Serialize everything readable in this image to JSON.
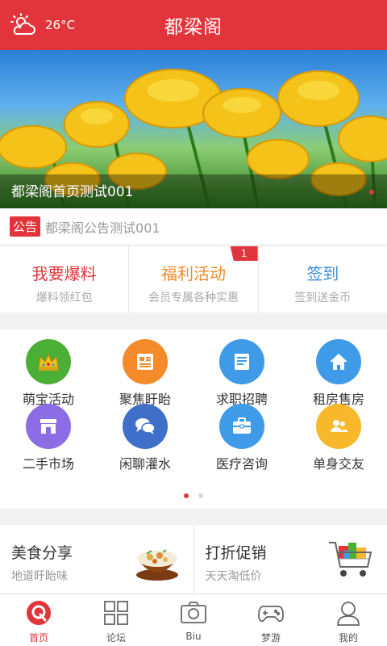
{
  "header": {
    "title": "都梁阁",
    "temperature": "26°C",
    "weather_icon": "partly-cloudy-icon"
  },
  "banner": {
    "caption": "都梁阁首页测试001",
    "slide_index": 1,
    "slide_count": 1
  },
  "notice": {
    "tag": "公告",
    "text": "都梁阁公告测试001"
  },
  "features": [
    {
      "title": "我要爆料",
      "subtitle": "爆料领红包",
      "color": "#e2353b"
    },
    {
      "title": "福利活动",
      "subtitle": "会员专属各种实惠",
      "color": "#f08a2a",
      "badge": "1"
    },
    {
      "title": "签到",
      "subtitle": "签到送金币",
      "color": "#3a8de0"
    }
  ],
  "categories": [
    {
      "label": "萌宝活动",
      "icon": "crown-icon",
      "color": "#4caf35"
    },
    {
      "label": "聚焦盱眙",
      "icon": "news-icon",
      "color": "#f58a2b"
    },
    {
      "label": "求职招聘",
      "icon": "document-icon",
      "color": "#3f9be8"
    },
    {
      "label": "租房售房",
      "icon": "house-icon",
      "color": "#3f9be8"
    },
    {
      "label": "二手市场",
      "icon": "shop-icon",
      "color": "#8d6de6"
    },
    {
      "label": "闲聊灌水",
      "icon": "chat-icon",
      "color": "#3f6fc8"
    },
    {
      "label": "医疗咨询",
      "icon": "medical-kit-icon",
      "color": "#3f9be8"
    },
    {
      "label": "单身交友",
      "icon": "people-icon",
      "color": "#f7b82c"
    }
  ],
  "category_pages": {
    "current": 1,
    "total": 2
  },
  "promos": [
    {
      "title": "美食分享",
      "subtitle": "地道盱眙味",
      "image": "food-bowl-image"
    },
    {
      "title": "打折促销",
      "subtitle": "天天淘低价",
      "image": "shopping-cart-image"
    }
  ],
  "tabs": [
    {
      "label": "首页",
      "icon": "home-q-icon",
      "active": true
    },
    {
      "label": "论坛",
      "icon": "grid-icon",
      "active": false
    },
    {
      "label": "Biu",
      "icon": "camera-icon",
      "active": false
    },
    {
      "label": "梦游",
      "icon": "gamepad-icon",
      "active": false
    },
    {
      "label": "我的",
      "icon": "user-icon",
      "active": false
    }
  ],
  "colors": {
    "brand": "#e2353b"
  }
}
